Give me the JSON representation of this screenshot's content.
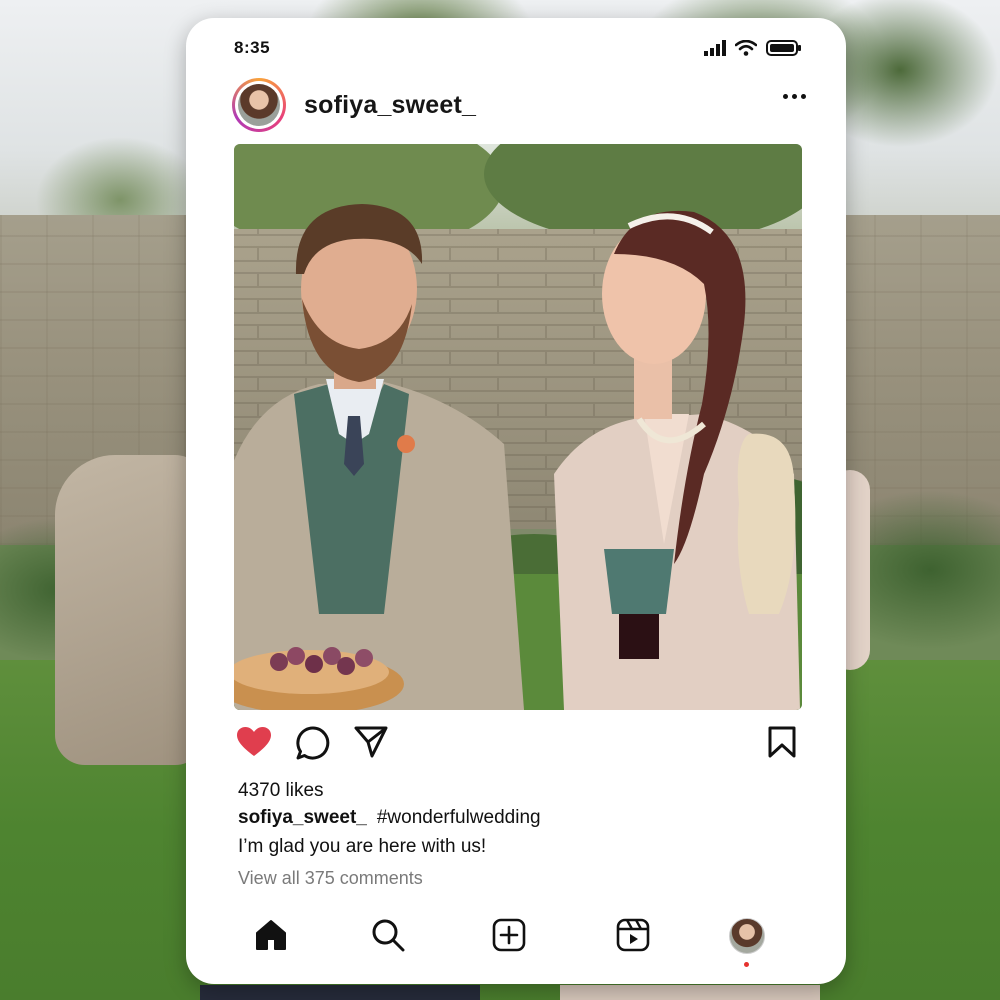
{
  "status_bar": {
    "time": "8:35",
    "icons": [
      "signal-icon",
      "wifi-icon",
      "battery-icon"
    ]
  },
  "post": {
    "username": "sofiya_sweet_",
    "menu_icon": "more-options-icon",
    "likes": "4370 likes",
    "liked": true,
    "caption_user": "sofiya_sweet_",
    "caption_text": "#wonderfulwedding",
    "subcaption": "I’m glad you are here with us!",
    "comments_link": "View all 375 comments",
    "actions": [
      "heart-icon",
      "comment-icon",
      "share-icon",
      "bookmark-icon"
    ]
  },
  "bottom_nav": [
    "home-icon",
    "search-icon",
    "create-post-icon",
    "reels-icon",
    "profile-avatar"
  ],
  "colors": {
    "like_red": "#e03e4e",
    "notification_dot": "#e5322e",
    "frame": "#ffffff",
    "text": "#111111",
    "muted_text": "#7a7a7a"
  }
}
